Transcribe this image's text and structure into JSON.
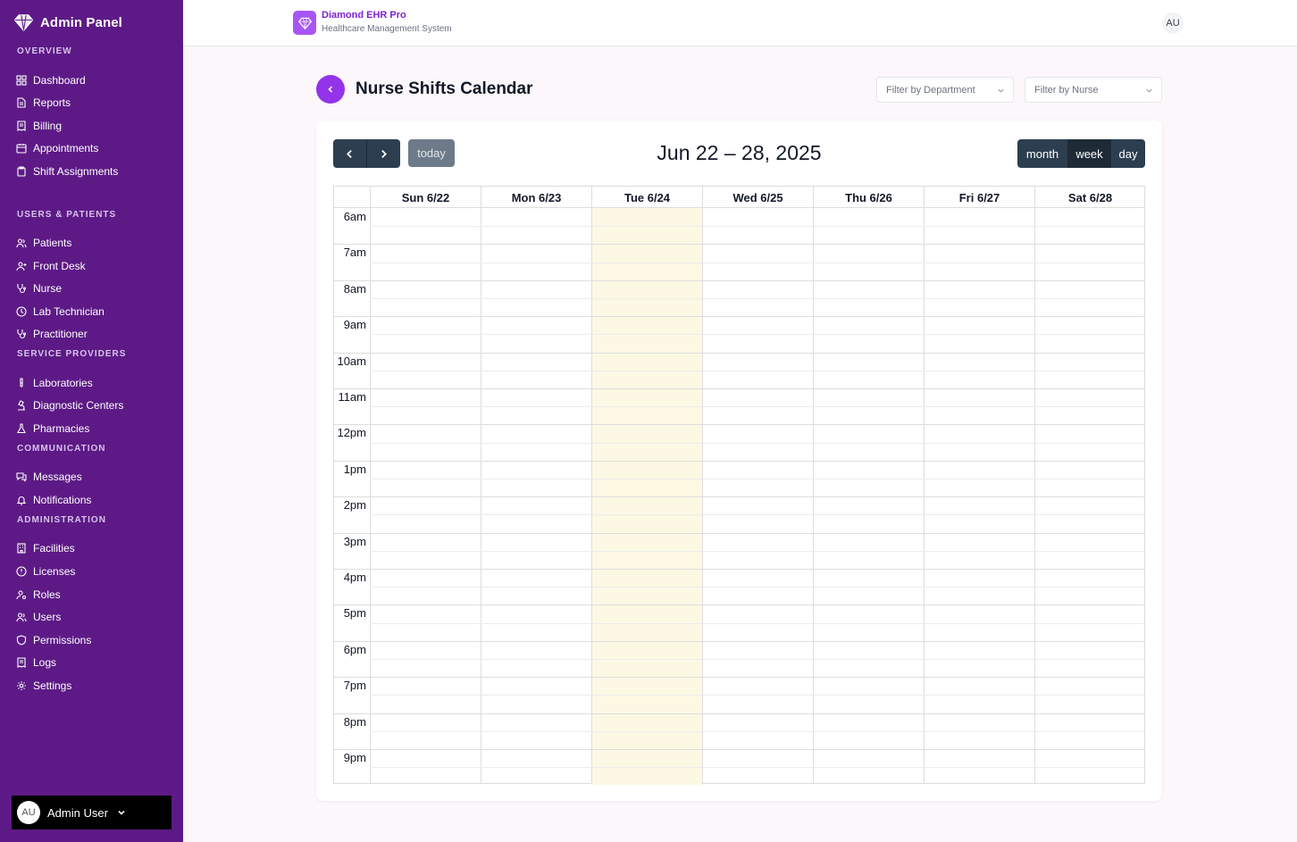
{
  "sidebar": {
    "title": "Admin Panel",
    "sections": {
      "overview": "OVERVIEW",
      "users_patients": "USERS & PATIENTS",
      "service_providers": "SERVICE PROVIDERS",
      "communication": "COMMUNICATION",
      "administration": "ADMINISTRATION"
    },
    "items": {
      "dashboard": "Dashboard",
      "reports": "Reports",
      "billing": "Billing",
      "appointments": "Appointments",
      "shift_assignments": "Shift Assignments",
      "patients": "Patients",
      "front_desk": "Front Desk",
      "nurse": "Nurse",
      "lab_technician": "Lab Technician",
      "practitioner": "Practitioner",
      "laboratories": "Laboratories",
      "diagnostic_centers": "Diagnostic Centers",
      "pharmacies": "Pharmacies",
      "messages": "Messages",
      "notifications": "Notifications",
      "facilities": "Facilities",
      "licenses": "Licenses",
      "roles": "Roles",
      "users": "Users",
      "permissions": "Permissions",
      "logs": "Logs",
      "settings": "Settings"
    },
    "user": {
      "initials": "AU",
      "name": "Admin User"
    }
  },
  "header": {
    "app_name": "Diamond EHR Pro",
    "app_subtitle": "Healthcare Management System",
    "avatar_initials": "AU"
  },
  "page": {
    "title": "Nurse Shifts Calendar",
    "filter_department_placeholder": "Filter by Department",
    "filter_nurse_placeholder": "Filter by Nurse"
  },
  "calendar": {
    "range_title": "Jun 22 – 28, 2025",
    "today_label": "today",
    "views": {
      "month": "month",
      "week": "week",
      "day": "day"
    },
    "active_view": "week",
    "today_index": 2,
    "days": [
      "Sun 6/22",
      "Mon 6/23",
      "Tue 6/24",
      "Wed 6/25",
      "Thu 6/26",
      "Fri 6/27",
      "Sat 6/28"
    ],
    "hours": [
      "6am",
      "7am",
      "8am",
      "9am",
      "10am",
      "11am",
      "12pm",
      "1pm",
      "2pm",
      "3pm",
      "4pm",
      "5pm",
      "6pm",
      "7pm",
      "8pm",
      "9pm"
    ],
    "today_highlight_color": "#fcf8e3"
  },
  "colors": {
    "sidebar_bg": "#5d1a86",
    "accent": "#9333ea",
    "calendar_button": "#2c3e50"
  }
}
